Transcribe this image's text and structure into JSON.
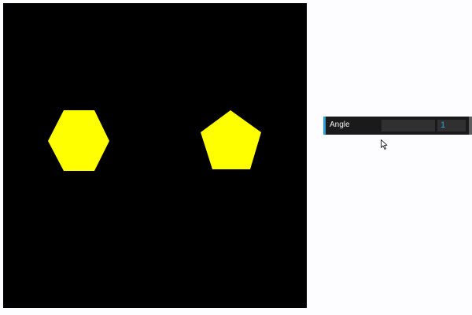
{
  "canvas": {
    "background": "#000000",
    "shapes": [
      {
        "name": "hexagon",
        "sides": 6,
        "color": "#ffff00"
      },
      {
        "name": "pentagon",
        "sides": 5,
        "color": "#ffff00"
      }
    ]
  },
  "controls": {
    "angle": {
      "label": "Angle",
      "value": "1",
      "slider_fraction": 0
    },
    "accent_color": "#2fa1d6"
  },
  "cursor": {
    "icon": "arrow-cursor-icon"
  }
}
